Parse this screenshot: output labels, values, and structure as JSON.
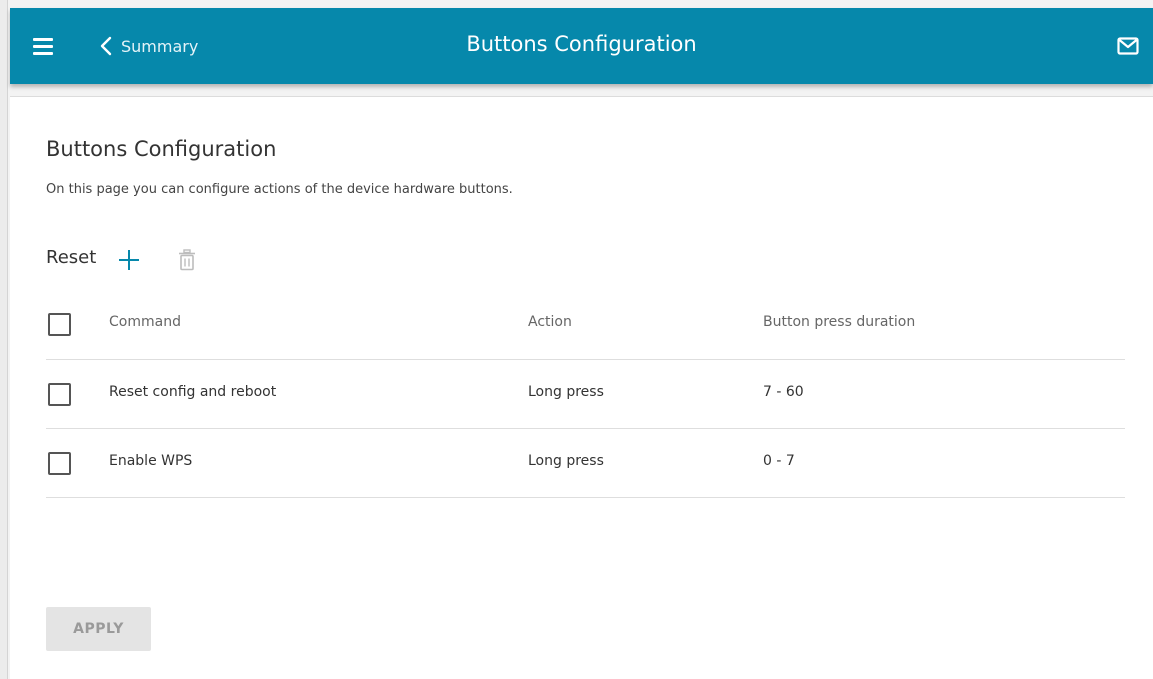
{
  "header": {
    "back_label": "Summary",
    "title": "Buttons Configuration",
    "menu_icon": "hamburger-menu-icon",
    "back_icon": "chevron-left-icon",
    "notifications_icon": "mail-icon"
  },
  "page": {
    "title": "Buttons Configuration",
    "description": "On this page you can configure actions of the device hardware buttons."
  },
  "section": {
    "title": "Reset",
    "add_icon": "plus-icon",
    "delete_icon": "trash-icon"
  },
  "table": {
    "columns": [
      "Command",
      "Action",
      "Button press duration"
    ],
    "rows": [
      {
        "command": "Reset config and reboot",
        "action": "Long press",
        "duration": "7 - 60",
        "checked": false
      },
      {
        "command": "Enable WPS",
        "action": "Long press",
        "duration": "0 - 7",
        "checked": false
      }
    ]
  },
  "actions": {
    "apply_label": "APPLY"
  },
  "colors": {
    "header_bg": "#0688ab",
    "accent": "#0688ab",
    "disabled_button_bg": "#e4e4e4"
  }
}
